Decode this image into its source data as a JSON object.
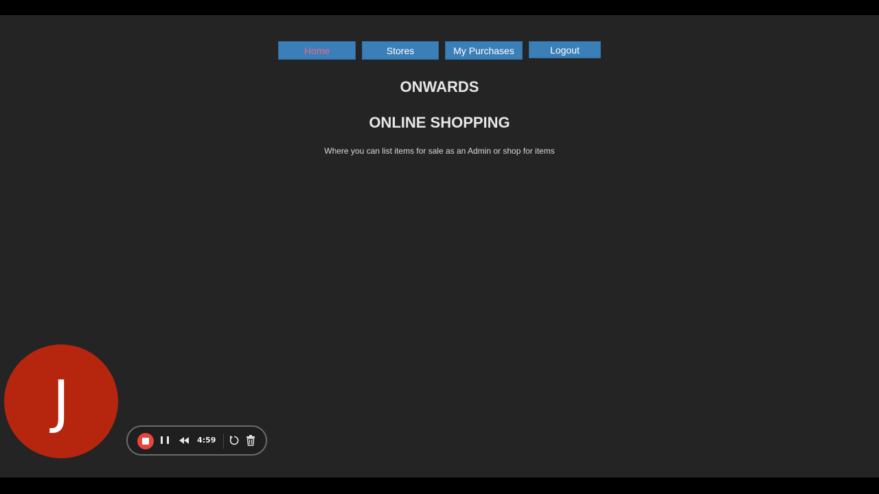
{
  "nav": {
    "home_label": "Home",
    "stores_label": "Stores",
    "purchases_label": "My Purchases",
    "logout_label": "Logout",
    "active": "Home"
  },
  "hero": {
    "title": "ONWARDS",
    "subtitle": "ONLINE SHOPPING",
    "tagline": "Where you can list items for sale as an Admin or shop for items"
  },
  "avatar": {
    "initial": "J",
    "color": "#b6260e"
  },
  "recorder": {
    "time": "4:59",
    "icons": [
      "stop-icon",
      "pause-icon",
      "rewind-icon",
      "restart-icon",
      "trash-icon"
    ],
    "stop_color": "#e8453c"
  },
  "colors": {
    "background": "#242424",
    "nav_button": "#3a7fb8",
    "active_text": "#e86a8e"
  }
}
